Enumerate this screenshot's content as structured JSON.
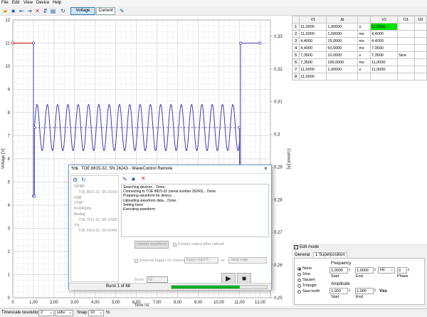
{
  "menu": [
    "File",
    "Edit",
    "View",
    "Device",
    "Help"
  ],
  "toolbar": {
    "tab_voltage": "Voltage",
    "tab_current": "Current"
  },
  "chart_data": {
    "type": "line",
    "xlabel": "Time [s]",
    "ylabel_left": "Voltage [V]",
    "ylabel_right": "Current [A]",
    "xlim": [
      0,
      12.5
    ],
    "ylim_left": [
      0,
      12
    ],
    "ylim_right": [
      0.25,
      0.335
    ],
    "x_ticks": [
      "0",
      "1,00",
      "2,00",
      "3,00",
      "4,00",
      "5,00",
      "6,00",
      "7,00",
      "8,00",
      "9,00",
      "10,00",
      "11,00",
      "12,00"
    ],
    "y_ticks_left": [
      "0",
      "1",
      "2",
      "3",
      "4",
      "5",
      "6",
      "7",
      "8",
      "9",
      "10",
      "11",
      "12"
    ],
    "y_ticks_right": [
      "0,25",
      "0,26",
      "0,27",
      "0,28",
      "0,29",
      "0,3",
      "0,31",
      "0,32",
      "0,33"
    ],
    "grid": true,
    "series": [
      {
        "color": "#c00000",
        "points": [
          [
            0,
            11
          ],
          [
            1,
            11
          ]
        ]
      },
      {
        "color": "#4040b0",
        "points": [
          [
            1,
            11
          ],
          [
            1,
            4.4
          ],
          [
            1.05,
            4.4
          ],
          [
            1.05,
            7.35
          ],
          [
            11,
            7.35
          ],
          [
            11,
            4.4
          ],
          [
            11.05,
            4.4
          ],
          [
            11.05,
            11
          ],
          [
            12,
            11
          ]
        ],
        "sine": {
          "x_start": 1.05,
          "x_end": 11,
          "center": 7.35,
          "amplitude": 1,
          "frequency": 2
        }
      }
    ]
  },
  "table": {
    "headers": [
      "",
      "V1",
      "Δt",
      "",
      "V2",
      "Ü1",
      "Ü2"
    ],
    "rows": [
      [
        "1",
        "11,0000",
        "1,00000",
        "s",
        "11,0000",
        "",
        ""
      ],
      [
        "2",
        "11,0000",
        "1,00000",
        "ms",
        "4,4000",
        "",
        ""
      ],
      [
        "3",
        "4,4000",
        "15,0000",
        "ms",
        "4,4000",
        "",
        ""
      ],
      [
        "4",
        "4,4000",
        "50,0000",
        "ms",
        "7,3500",
        "",
        ""
      ],
      [
        "5",
        "7,3500",
        "10,0000",
        "s",
        "7,3500",
        "Sine",
        ""
      ],
      [
        "6",
        "7,3500",
        "100,0000",
        "ms",
        "11,0000",
        "",
        ""
      ],
      [
        "7",
        "11,0000",
        "1,00000",
        "s",
        "11,0000",
        "",
        ""
      ],
      [
        "8",
        "11,0000",
        "",
        "",
        "",
        "",
        ""
      ]
    ],
    "highlight_color": "#00e000"
  },
  "panel": {
    "edit_mode": "Edit mode",
    "tab_general": "General",
    "tab_superposition": "1 Superposition",
    "waveforms": [
      "None",
      "Sine",
      "Square",
      "Triangle",
      "Saw tooth"
    ],
    "frequency_label": "Frequency",
    "freq_start": "1,0000",
    "freq_end": "1,0000",
    "freq_unit": "Hz",
    "phase": "0",
    "start_label": "Start",
    "end_label": "End",
    "phase_label": "Phase",
    "amplitude_label": "Amplitude",
    "amp_start": "1,000",
    "amp_end": "1,000",
    "vss": "Vss"
  },
  "dialog": {
    "title_logo": "TOE",
    "title": "TOE 8815-32, SN 26243 - WaveControl Remote",
    "tree": [
      "GPIB0",
      "TOE 8815-32, SN 26243",
      "USB",
      "COM",
      "NI-DAQmx",
      "Analog",
      "TOE 7621-32, SN 10935",
      "TTL",
      "TOE 9261-50, SN 92496"
    ],
    "log": [
      "Searching devices... Done.",
      "Connecting to TOE 8815-32 (serial number 26243)... Done.",
      "Preparing waveform for device...",
      "Uploading waveform data... Done.",
      "Setting burst",
      "Executing waveform"
    ],
    "upload_button": "Upload waveform",
    "enable_output": "Enable output after upload",
    "external_trigger": "External trigger on channel",
    "trigger_input": "trigger input 0",
    "on_label": "on",
    "rising_edge": "rising edge",
    "burst_label": "Burst",
    "burst_value": "68",
    "progress_text": "Burst 1 of 68",
    "progress": 0.72
  },
  "statusbar": {
    "timescale_label": "Timescale resolution:",
    "timescale_value": "2",
    "timescale_unit": "s/div",
    "snap_label": "Snap:",
    "snap_value": "10",
    "percent": "%"
  }
}
